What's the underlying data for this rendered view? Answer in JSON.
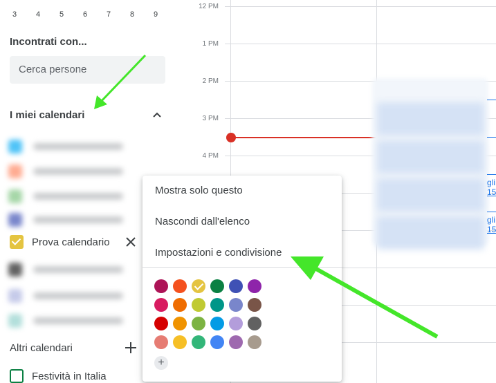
{
  "mini_calendar": {
    "days": [
      "3",
      "4",
      "5",
      "6",
      "7",
      "8",
      "9"
    ]
  },
  "meet_with": {
    "title": "Incontrati con...",
    "search_placeholder": "Cerca persone"
  },
  "my_calendars": {
    "title": "I miei calendari",
    "items": [
      {
        "label": "Prova calendario",
        "checked": true,
        "color": "#e4c441"
      }
    ]
  },
  "other_calendars": {
    "title": "Altri calendari",
    "items": [
      {
        "label": "Festività in Italia",
        "checked": false,
        "color": "#0b8043"
      }
    ]
  },
  "time_labels": [
    "12 PM",
    "1 PM",
    "2 PM",
    "3 PM",
    "4 PM"
  ],
  "edge_events": [
    {
      "line1": "gli",
      "line2": "15"
    },
    {
      "line1": "gli",
      "line2": "15"
    }
  ],
  "context_menu": {
    "items": [
      {
        "label": "Mostra solo questo"
      },
      {
        "label": "Nascondi dall'elenco"
      },
      {
        "label": "Impostazioni e condivisione"
      }
    ],
    "colors": [
      "#ad1457",
      "#f4511e",
      "#e4c441",
      "#0b8043",
      "#3f51b5",
      "#8e24aa",
      "#d81b60",
      "#ef6c00",
      "#c0ca33",
      "#009688",
      "#7986cb",
      "#795548",
      "#d50000",
      "#f09300",
      "#7cb342",
      "#039be5",
      "#b39ddb",
      "#616161",
      "#e67c73",
      "#f6bf26",
      "#33b679",
      "#4285f4",
      "#9e69af",
      "#a79b8e"
    ],
    "selected_color": "#e4c441",
    "add_color_symbol": "+"
  },
  "colors": {
    "now_indicator": "#d93025",
    "annotation_arrow": "#44e62a"
  }
}
